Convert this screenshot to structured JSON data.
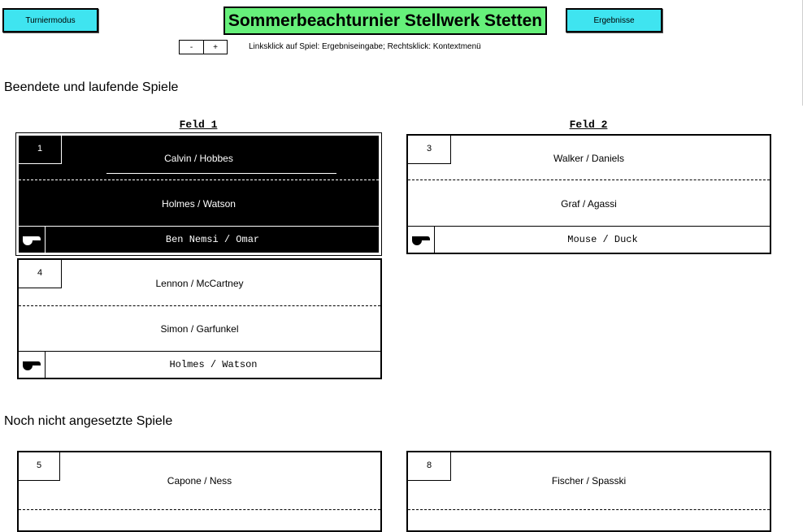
{
  "header": {
    "mode_button": "Turniermodus",
    "title": "Sommerbeachturnier Stellwerk Stetten",
    "results_button": "Ergebnisse",
    "zoom_out": "-",
    "zoom_in": "+",
    "hint": "Linksklick auf Spiel: Ergebniseingabe; Rechtsklick: Kontextmenü"
  },
  "sections": {
    "running": "Beendete und laufende Spiele",
    "pending": "Noch nicht angesetzte Spiele"
  },
  "fields": {
    "field1": "Feld 1",
    "field2": "Feld 2"
  },
  "games": {
    "g1": {
      "number": "1",
      "team_a": "Calvin / Hobbes",
      "team_b": "Holmes / Watson",
      "referee": "Ben Nemsi / Omar",
      "active": true
    },
    "g3": {
      "number": "3",
      "team_a": "Walker / Daniels",
      "team_b": "Graf / Agassi",
      "referee": "Mouse / Duck"
    },
    "g4": {
      "number": "4",
      "team_a": "Lennon / McCartney",
      "team_b": "Simon / Garfunkel",
      "referee": "Holmes / Watson"
    },
    "g5": {
      "number": "5",
      "team_a": "Capone / Ness"
    },
    "g8": {
      "number": "8",
      "team_a": "Fischer / Spasski"
    }
  },
  "icons": {
    "referee": "whistle-icon"
  }
}
